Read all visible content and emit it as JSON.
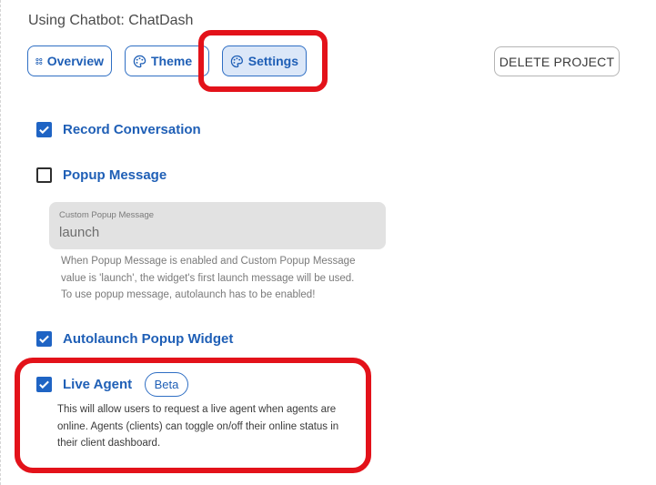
{
  "header": {
    "title": "Using Chatbot: ChatDash"
  },
  "tabs": [
    {
      "label": "Overview",
      "icon": "apps-icon"
    },
    {
      "label": "Theme",
      "icon": "palette-icon"
    },
    {
      "label": "Settings",
      "icon": "palette-icon",
      "active": true
    }
  ],
  "actions": {
    "delete_label": "DELETE PROJECT"
  },
  "settings": {
    "record_conversation": {
      "label": "Record Conversation",
      "checked": true
    },
    "popup_message": {
      "label": "Popup Message",
      "checked": false
    },
    "custom_popup": {
      "label": "Custom Popup Message",
      "value": "launch",
      "helper_line1": "When Popup Message is enabled and Custom Popup Message",
      "helper_line2": "value is 'launch', the widget's first launch message will be used.",
      "helper_line3": "To use popup message, autolaunch has to be enabled!"
    },
    "autolaunch": {
      "label": "Autolaunch Popup Widget",
      "checked": true
    },
    "live_agent": {
      "label": "Live Agent",
      "checked": true,
      "badge": "Beta",
      "desc_line1": "This will allow users to request a live agent when agents are",
      "desc_line2": "online. Agents (clients) can toggle on/off their online status in",
      "desc_line3": "their client dashboard."
    }
  },
  "colors": {
    "accent": "#1f5fb6",
    "checkbox": "#1f64c4",
    "annotation": "#e3121a"
  }
}
